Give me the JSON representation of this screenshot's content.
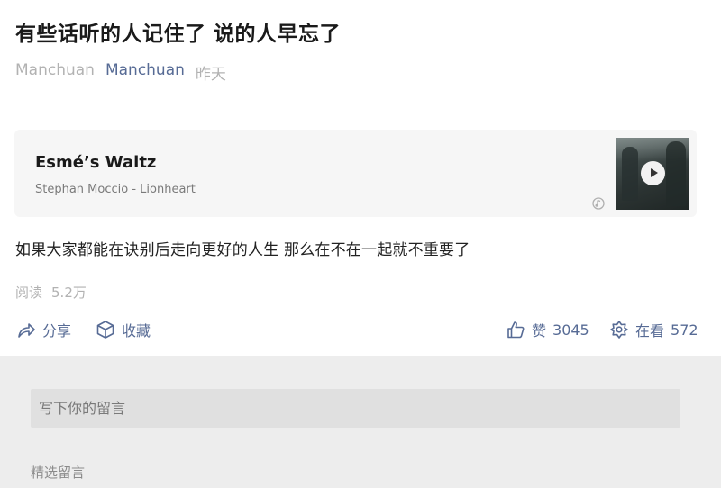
{
  "article": {
    "title": "有些话听的人记住了 说的人早忘了",
    "author": "Manchuan",
    "account": "Manchuan",
    "date": "昨天",
    "body": "如果大家都能在诀别后走向更好的人生 那么在不在一起就不重要了"
  },
  "music": {
    "song": "Esmé’s Waltz",
    "artist": "Stephan Moccio - Lionheart",
    "play_icon": "play-icon",
    "source_icon": "qq-music-icon"
  },
  "stats": {
    "reads_label": "阅读",
    "reads_value": "5.2万"
  },
  "actions": {
    "share_label": "分享",
    "favorite_label": "收藏",
    "like_label": "赞",
    "like_count": "3045",
    "watch_label": "在看",
    "watch_count": "572"
  },
  "comments": {
    "placeholder": "写下你的留言",
    "section_title": "精选留言"
  },
  "colors": {
    "link": "#576b95",
    "muted": "#b2b2b2",
    "card_bg": "#f6f6f6",
    "comment_bg": "#ededed"
  }
}
